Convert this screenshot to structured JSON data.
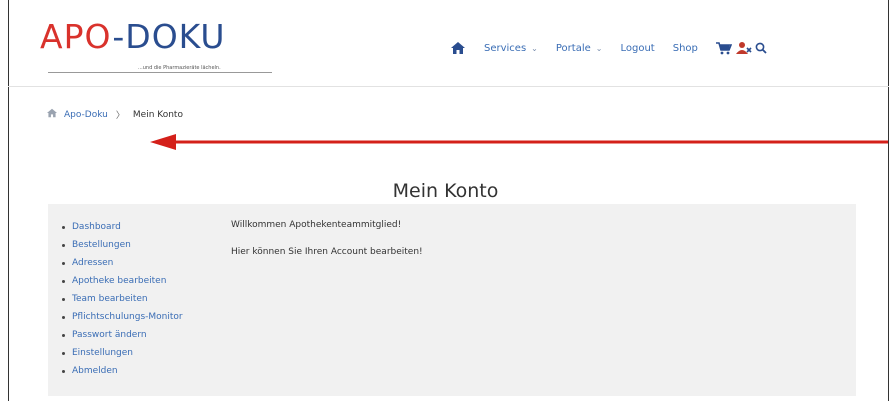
{
  "logo": {
    "part1": "APO",
    "dash": "-",
    "part2": "DOKU",
    "tagline": "...und die Pharmazieräte lächeln."
  },
  "nav": {
    "items": [
      {
        "label": "Services",
        "chevron": "⌄"
      },
      {
        "label": "Portale",
        "chevron": "⌄"
      },
      {
        "label": "Logout"
      },
      {
        "label": "Shop"
      }
    ]
  },
  "breadcrumb": {
    "home_label": "Apo-Doku",
    "separator": "〉",
    "current": "Mein Konto"
  },
  "page": {
    "title": "Mein Konto"
  },
  "account_menu": [
    "Dashboard",
    "Bestellungen",
    "Adressen",
    "Apotheke bearbeiten",
    "Team bearbeiten",
    "Pflichtschulungs-Monitor",
    "Passwort ändern",
    "Einstellungen",
    "Abmelden"
  ],
  "content": {
    "welcome": "Willkommen Apothekenteammitglied!",
    "hint": "Hier können Sie Ihren Account bearbeiten!"
  },
  "colors": {
    "accent": "#3a6db5",
    "logo_red": "#d9322c",
    "logo_blue": "#2a4d8f",
    "arrow": "#d4201a",
    "panel_bg": "#f1f1f1"
  },
  "icons": [
    "home-icon",
    "cart-icon",
    "user-x-icon",
    "search-icon",
    "chevron-right-icon"
  ]
}
